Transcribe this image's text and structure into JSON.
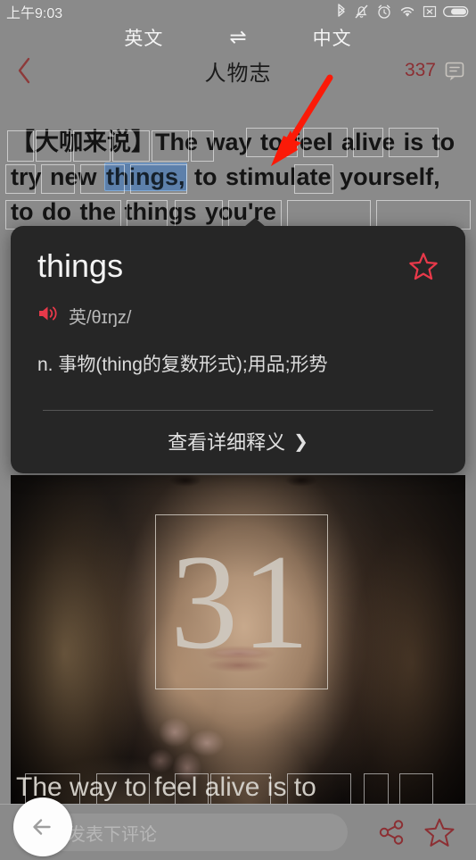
{
  "status_bar": {
    "time": "上午9:03",
    "icons": [
      "bluetooth-icon",
      "silent-mode-icon",
      "alarm-clock-icon",
      "wifi-icon",
      "no-signal-icon",
      "battery-icon"
    ]
  },
  "lang_bar": {
    "source_label": "英文",
    "swap_icon": "⇌",
    "target_label": "中文"
  },
  "top_nav": {
    "back_icon": "chevron-left-icon",
    "title": "人物志",
    "comment_count": "337",
    "comment_icon": "comment-bubble-icon"
  },
  "article": {
    "prefix": "【大咖来说】",
    "line_text_1": "The way to feel alive",
    "line_text_2a": "is to try new ",
    "highlighted_word": "things,",
    "line_text_2b": " to stimulate",
    "line_text_3": "yourself, to do the things you're"
  },
  "dictionary_popup": {
    "word": "things",
    "star_icon": "star-outline-icon",
    "speaker_icon": "speaker-icon",
    "pronunciation": "英/θɪŋz/",
    "definition": "n. 事物(thing的复数形式);用品;形势",
    "more_label": "查看详细释义",
    "more_chevron": "❯"
  },
  "hero": {
    "number": "31",
    "caption": "The way to feel alive is to"
  },
  "bottom_bar": {
    "comment_placeholder": "我来发表下评论",
    "share_icon": "share-icon",
    "favorite_icon": "star-outline-icon"
  },
  "fab": {
    "back_icon": "arrow-left-icon"
  },
  "annotation": {
    "arrow_icon": "red-pointer-arrow-icon"
  },
  "colors": {
    "accent_red": "#e8394a",
    "maroon": "#8c2f33",
    "highlight_blue": "#5d80ab",
    "card_bg": "#262626",
    "page_bg": "#8a8a8a"
  }
}
